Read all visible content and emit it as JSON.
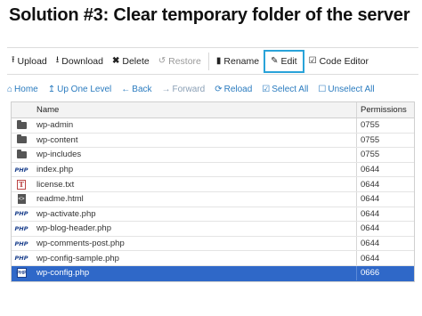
{
  "slide": {
    "title": "Solution #3: Clear temporary folder of the server"
  },
  "toolbar": {
    "upload": "Upload",
    "download": "Download",
    "delete": "Delete",
    "restore": "Restore",
    "rename": "Rename",
    "edit": "Edit",
    "code_editor": "Code Editor"
  },
  "nav": {
    "home": "Home",
    "up_one_level": "Up One Level",
    "back": "Back",
    "forward": "Forward",
    "reload": "Reload",
    "select_all": "Select All",
    "unselect_all": "Unselect All"
  },
  "file_list": {
    "columns": {
      "name": "Name",
      "permissions": "Permissions"
    },
    "rows": [
      {
        "name": "wp-admin",
        "permissions": "0755",
        "icon": "folder-icon"
      },
      {
        "name": "wp-content",
        "permissions": "0755",
        "icon": "folder-icon"
      },
      {
        "name": "wp-includes",
        "permissions": "0755",
        "icon": "folder-icon"
      },
      {
        "name": "index.php",
        "permissions": "0644",
        "icon": "php-file-icon"
      },
      {
        "name": "license.txt",
        "permissions": "0644",
        "icon": "text-file-icon"
      },
      {
        "name": "readme.html",
        "permissions": "0644",
        "icon": "html-file-icon"
      },
      {
        "name": "wp-activate.php",
        "permissions": "0644",
        "icon": "php-file-icon"
      },
      {
        "name": "wp-blog-header.php",
        "permissions": "0644",
        "icon": "php-file-icon"
      },
      {
        "name": "wp-comments-post.php",
        "permissions": "0644",
        "icon": "php-file-icon"
      },
      {
        "name": "wp-config-sample.php",
        "permissions": "0644",
        "icon": "php-file-icon"
      },
      {
        "name": "wp-config.php",
        "permissions": "0666",
        "icon": "config-file-icon"
      }
    ]
  }
}
